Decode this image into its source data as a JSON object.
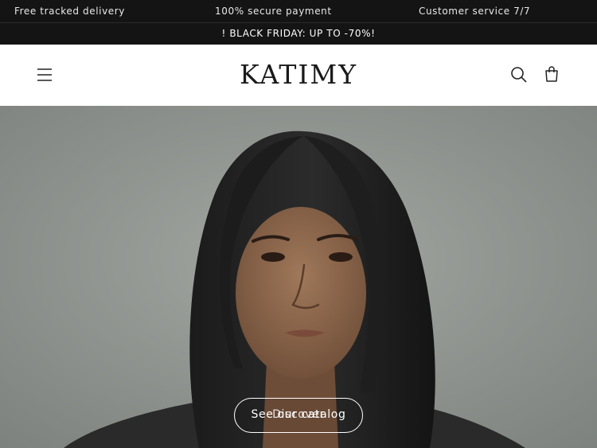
{
  "topbar": {
    "item1": "Free tracked delivery",
    "item2": "100% secure payment",
    "item3": "Customer service 7/7"
  },
  "announcement": "! BLACK FRIDAY: UP TO -70%!",
  "header": {
    "logo": "KATIMY",
    "menu_icon": "hamburger-menu-icon",
    "search_icon": "search-icon",
    "cart_icon": "shopping-bag-icon"
  },
  "hero": {
    "cta_label": "See our catalog",
    "cta_overlap_label": "Discover"
  },
  "colors": {
    "bar_bg": "#141414",
    "hero_bg": "#8c918d"
  }
}
